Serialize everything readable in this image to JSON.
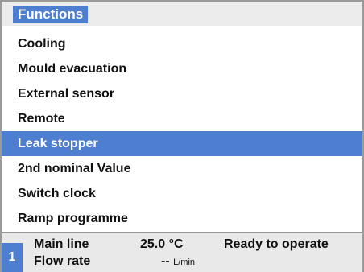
{
  "header": {
    "title": "Functions"
  },
  "menu": {
    "items": [
      {
        "label": "Cooling",
        "selected": false
      },
      {
        "label": "Mould evacuation",
        "selected": false
      },
      {
        "label": "External sensor",
        "selected": false
      },
      {
        "label": "Remote",
        "selected": false
      },
      {
        "label": "Leak stopper",
        "selected": true
      },
      {
        "label": "2nd nominal Value",
        "selected": false
      },
      {
        "label": "Switch clock",
        "selected": false
      },
      {
        "label": "Ramp programme",
        "selected": false
      }
    ]
  },
  "status": {
    "channel": "1",
    "main_line_label": "Main line",
    "main_line_value": "25.0 °C",
    "flow_rate_label": "Flow rate",
    "flow_rate_value": "--",
    "flow_rate_unit": "L/min",
    "message": "Ready to operate"
  },
  "colors": {
    "accent": "#4d7ecf",
    "header_bg": "#ececec",
    "status_bg": "#e9e9e9"
  }
}
